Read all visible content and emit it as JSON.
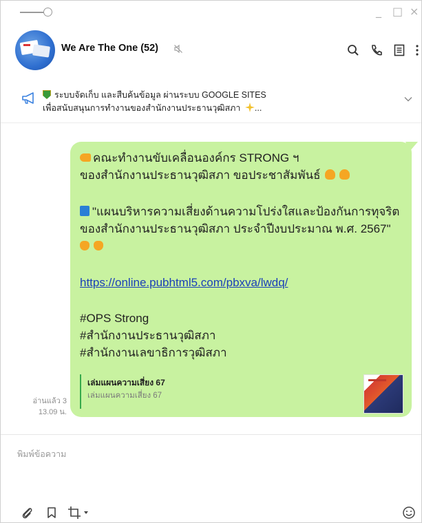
{
  "window": {
    "controls": [
      "_",
      "□",
      "×"
    ]
  },
  "header": {
    "group_name": "We Are The One (52)",
    "icons": [
      "search-icon",
      "phone-icon",
      "notes-icon",
      "more-icon"
    ]
  },
  "announcement": {
    "line1": "ระบบจัดเก็บ และสืบค้นข้อมูล ผ่านระบบ GOOGLE SITES",
    "line2": "เพื่อสนับสนุนการทำงานของสำนักงานประธานวุฒิสภา",
    "line2_suffix": "..."
  },
  "message": {
    "line1": "คณะทำงานขับเคลื่อนองค์กร STRONG ฯ",
    "line2": "ของสำนักงานประธานวุฒิสภา ขอประชาสัมพันธ์",
    "line3": "\"แผนบริหารความเสี่ยงด้านความโปร่งใสและป้องกันการทุจริต",
    "line4": "ของสำนักงานประธานวุฒิสภา ประจำปีงบประมาณ พ.ศ. 2567\"",
    "link": "https://online.pubhtml5.com/pbxva/lwdq/",
    "tag1": "#OPS Strong",
    "tag2": "#สำนักงานประธานวุฒิสภา",
    "tag3": "#สำนักงานเลขาธิการวุฒิสภา",
    "bubble_color": "#c8f2a0",
    "link_color": "#1a3fb8"
  },
  "link_preview": {
    "title": "เล่มแผนความเสี่ยง 67",
    "subtitle": "เล่มแผนความเสี่ยง 67"
  },
  "meta": {
    "read": "อ่านแล้ว 3",
    "time": "13.09 น."
  },
  "composer": {
    "placeholder": "พิมพ์ข้อความ"
  }
}
